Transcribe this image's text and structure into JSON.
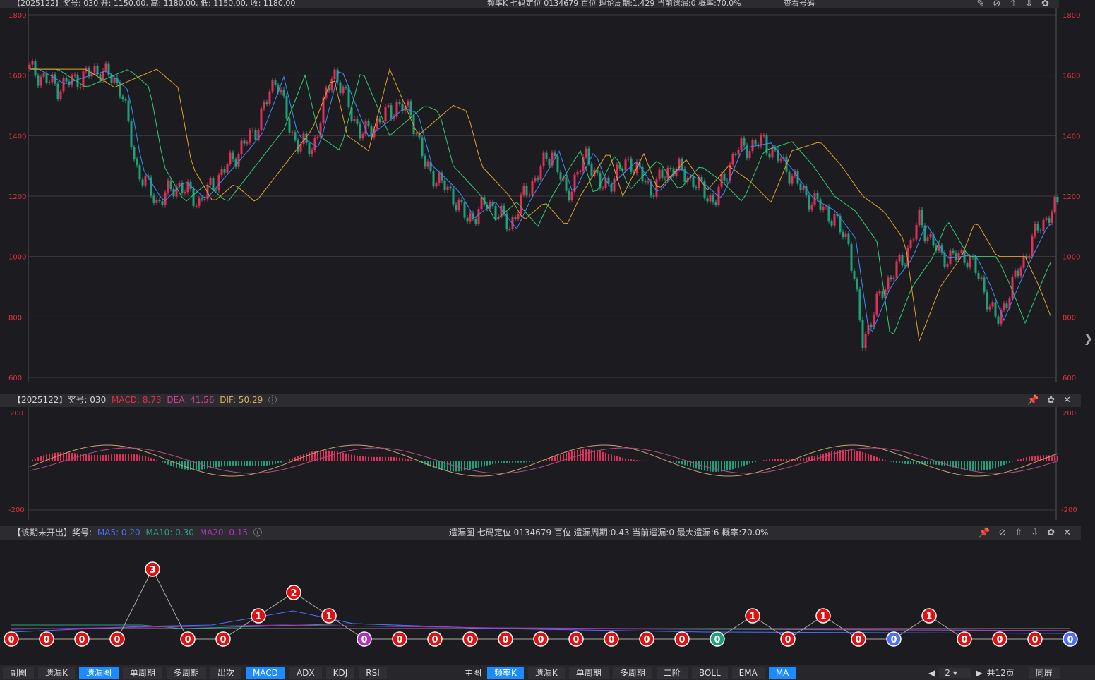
{
  "top": {
    "left": "【2025122】奖号: 030  开: 1150.00, 高: 1180.00, 低: 1150.00, 收: 1180.00",
    "center": "频率K  七码定位  0134679  百位  理论周期:1.429  当前遗漏:0  概率:70.0%",
    "link": "查看号码"
  },
  "main_axis": [
    "1800",
    "1600",
    "1400",
    "1200",
    "1000",
    "800",
    "600"
  ],
  "macd": {
    "prefix": "【2025122】奖号: 030",
    "macd": "MACD: 8.73",
    "dea": "DEA: 41.56",
    "dif": "DIF: 50.29",
    "axis_top": "200",
    "axis_bot": "-200"
  },
  "miss": {
    "prefix": "【该期未开出】奖号:",
    "ma5": "MA5: 0.20",
    "ma10": "MA10: 0.30",
    "ma20": "MA20: 0.15",
    "center": "遗漏图  七码定位  0134679  百位  遗漏周期:0.43  当前遗漏:0  最大遗漏:6  概率:70.0%",
    "values": [
      0,
      0,
      0,
      0,
      3,
      0,
      0,
      1,
      2,
      1,
      0,
      0,
      0,
      0,
      0,
      0,
      0,
      0,
      0,
      0,
      0,
      1,
      0,
      1,
      0,
      0,
      1,
      0,
      0,
      0,
      0
    ]
  },
  "bottom": {
    "left_buttons": [
      "副图",
      "遗漏K",
      "遗漏图",
      "单周期",
      "多周期",
      "出次",
      "MACD",
      "ADX",
      "KDJ",
      "RSI"
    ],
    "left_active": [
      "遗漏图",
      "MACD"
    ],
    "right_label": "主图",
    "right_buttons": [
      "频率K",
      "遗漏K",
      "单周期",
      "多周期",
      "二阶",
      "BOLL",
      "EMA",
      "MA"
    ],
    "right_active": [
      "频率K",
      "MA"
    ],
    "page": "2",
    "total": "共12页",
    "screen": "同屏"
  }
}
